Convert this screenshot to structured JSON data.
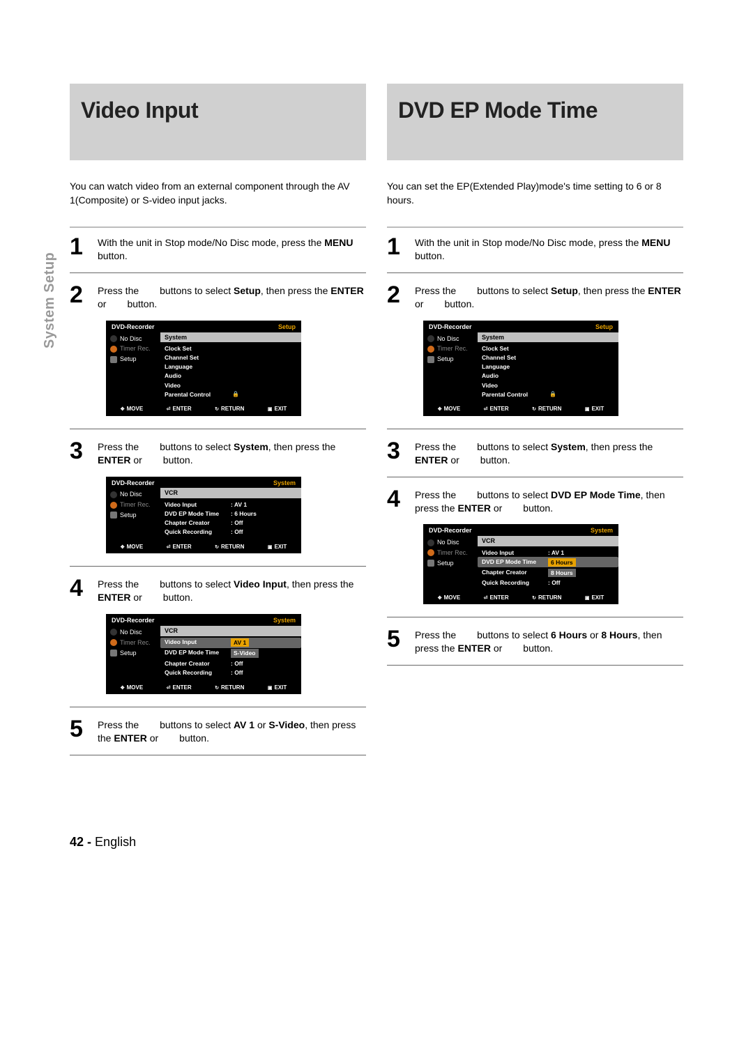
{
  "side_label": "System Setup",
  "footer": {
    "page": "42 -",
    "lang": "English"
  },
  "osd_common": {
    "recorder": "DVD-Recorder",
    "left": {
      "nodisc": "No Disc",
      "timer": "Timer Rec.",
      "setup": "Setup"
    },
    "foot": {
      "move": "MOVE",
      "enter": "ENTER",
      "return": "RETURN",
      "exit": "EXIT"
    }
  },
  "left_col": {
    "title": "Video Input",
    "intro": "You can watch video from an external component through the AV 1(Composite) or S-video input jacks.",
    "steps": {
      "s1": {
        "no": "1",
        "p1": "With the unit in Stop mode/No Disc mode, press the ",
        "b1": "MENU",
        "p2": " button."
      },
      "s2": {
        "no": "2",
        "p1": "Press the",
        "p2": "buttons to select ",
        "b1": "Setup",
        "p3": ", then press the ",
        "b2": "ENTER",
        "p4": " or",
        "p5": "button."
      },
      "s3": {
        "no": "3",
        "p1": "Press the",
        "p2": "buttons to select ",
        "b1": "System",
        "p3": ", then press the ",
        "b2": "ENTER",
        "p4": " or",
        "p5": "button."
      },
      "s4": {
        "no": "4",
        "p1": "Press the",
        "p2": "buttons to select ",
        "b1": "Video Input",
        "p3": ", then press the ",
        "b2": "ENTER",
        "p4": " or",
        "p5": "button."
      },
      "s5": {
        "no": "5",
        "p1": "Press the",
        "p2": "buttons to select ",
        "b1": "AV 1",
        "p3": " or ",
        "b2": "S-Video",
        "p4": ", then press the ",
        "b3": "ENTER",
        "p5": " or",
        "p6": "button."
      }
    },
    "osd2": {
      "mode": "Setup",
      "header": "System",
      "rows": [
        "Clock Set",
        "Channel Set",
        "Language",
        "Audio",
        "Video",
        "Parental Control"
      ]
    },
    "osd3": {
      "mode": "System",
      "header": "VCR",
      "rows": [
        {
          "lbl": "Video Input",
          "val": ": AV 1"
        },
        {
          "lbl": "DVD EP Mode Time",
          "val": ": 6 Hours"
        },
        {
          "lbl": "Chapter Creator",
          "val": ": Off"
        },
        {
          "lbl": "Quick Recording",
          "val": ": Off"
        }
      ]
    },
    "osd4": {
      "mode": "System",
      "header": "VCR",
      "rows": [
        {
          "lbl": "Video Input",
          "hl_val": "AV 1",
          "hl": true
        },
        {
          "lbl": "DVD EP Mode Time",
          "val": "S-Video",
          "popval": true
        },
        {
          "lbl": "Chapter Creator",
          "val": ": Off"
        },
        {
          "lbl": "Quick Recording",
          "val": ": Off"
        }
      ]
    }
  },
  "right_col": {
    "title": "DVD EP Mode Time",
    "intro": "You can set the EP(Extended Play)mode's time setting to 6 or 8 hours.",
    "steps": {
      "s1": {
        "no": "1",
        "p1": "With the unit in Stop mode/No Disc mode, press the ",
        "b1": "MENU",
        "p2": " button."
      },
      "s2": {
        "no": "2",
        "p1": "Press the",
        "p2": "buttons to select ",
        "b1": "Setup",
        "p3": ", then press the ",
        "b2": "ENTER",
        "p4": " or",
        "p5": "button."
      },
      "s3": {
        "no": "3",
        "p1": "Press the",
        "p2": "buttons to select ",
        "b1": "System",
        "p3": ", then press the ",
        "b2": "ENTER",
        "p4": " or",
        "p5": "button."
      },
      "s4": {
        "no": "4",
        "p1": "Press the",
        "p2": "buttons to select ",
        "b1": "DVD EP Mode Time",
        "p3": ", then press the ",
        "b2": "ENTER",
        "p4": " or",
        "p5": "button."
      },
      "s5": {
        "no": "5",
        "p1": "Press the",
        "p2": "buttons to select ",
        "b1": "6 Hours",
        "p3": " or ",
        "b2": "8 Hours",
        "p4": ", then press the ",
        "b3": "ENTER",
        "p5": " or",
        "p6": "button."
      }
    },
    "osd2": {
      "mode": "Setup",
      "header": "System",
      "rows": [
        "Clock Set",
        "Channel Set",
        "Language",
        "Audio",
        "Video",
        "Parental Control"
      ]
    },
    "osd4": {
      "mode": "System",
      "header": "VCR",
      "rows": [
        {
          "lbl": "Video Input",
          "val": ": AV 1"
        },
        {
          "lbl": "DVD EP Mode Time",
          "hl_val": "6 Hours",
          "hl": true
        },
        {
          "lbl": "Chapter Creator",
          "popval": "8 Hours"
        },
        {
          "lbl": "Quick Recording",
          "val": ": Off"
        }
      ]
    }
  }
}
